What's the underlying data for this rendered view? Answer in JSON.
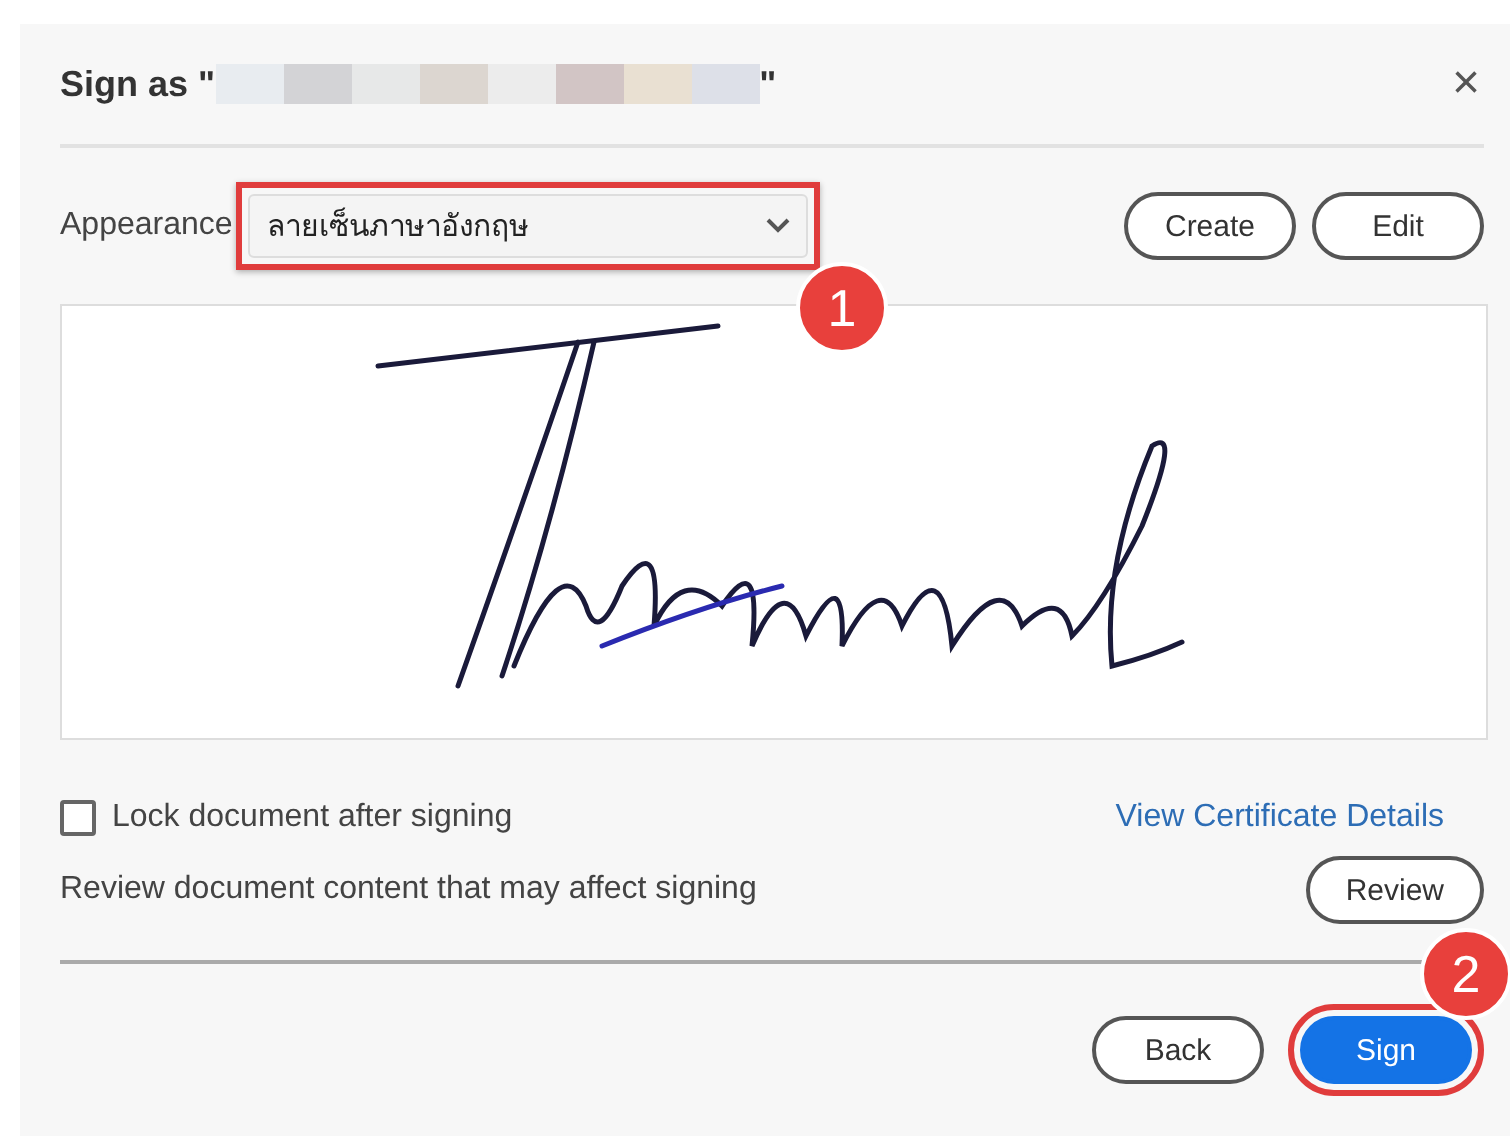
{
  "dialog": {
    "title_prefix": "Sign as \"",
    "title_suffix": "\"",
    "close": "×"
  },
  "appearance": {
    "label": "Appearance",
    "value": "ลายเซ็นภาษาอังกฤษ",
    "highlighted": true,
    "callout": "1"
  },
  "actions": [
    "Create",
    "Edit"
  ],
  "lock": {
    "label": "Lock document after signing",
    "checked": false
  },
  "certificate_link": "View Certificate Details",
  "review": {
    "text": "Review document content that may affect signing",
    "button": "Review"
  },
  "footer": [
    {
      "label": "Back",
      "primary": false,
      "highlighted": false
    },
    {
      "label": "Sign",
      "primary": true,
      "highlighted": true,
      "callout": "2"
    }
  ]
}
